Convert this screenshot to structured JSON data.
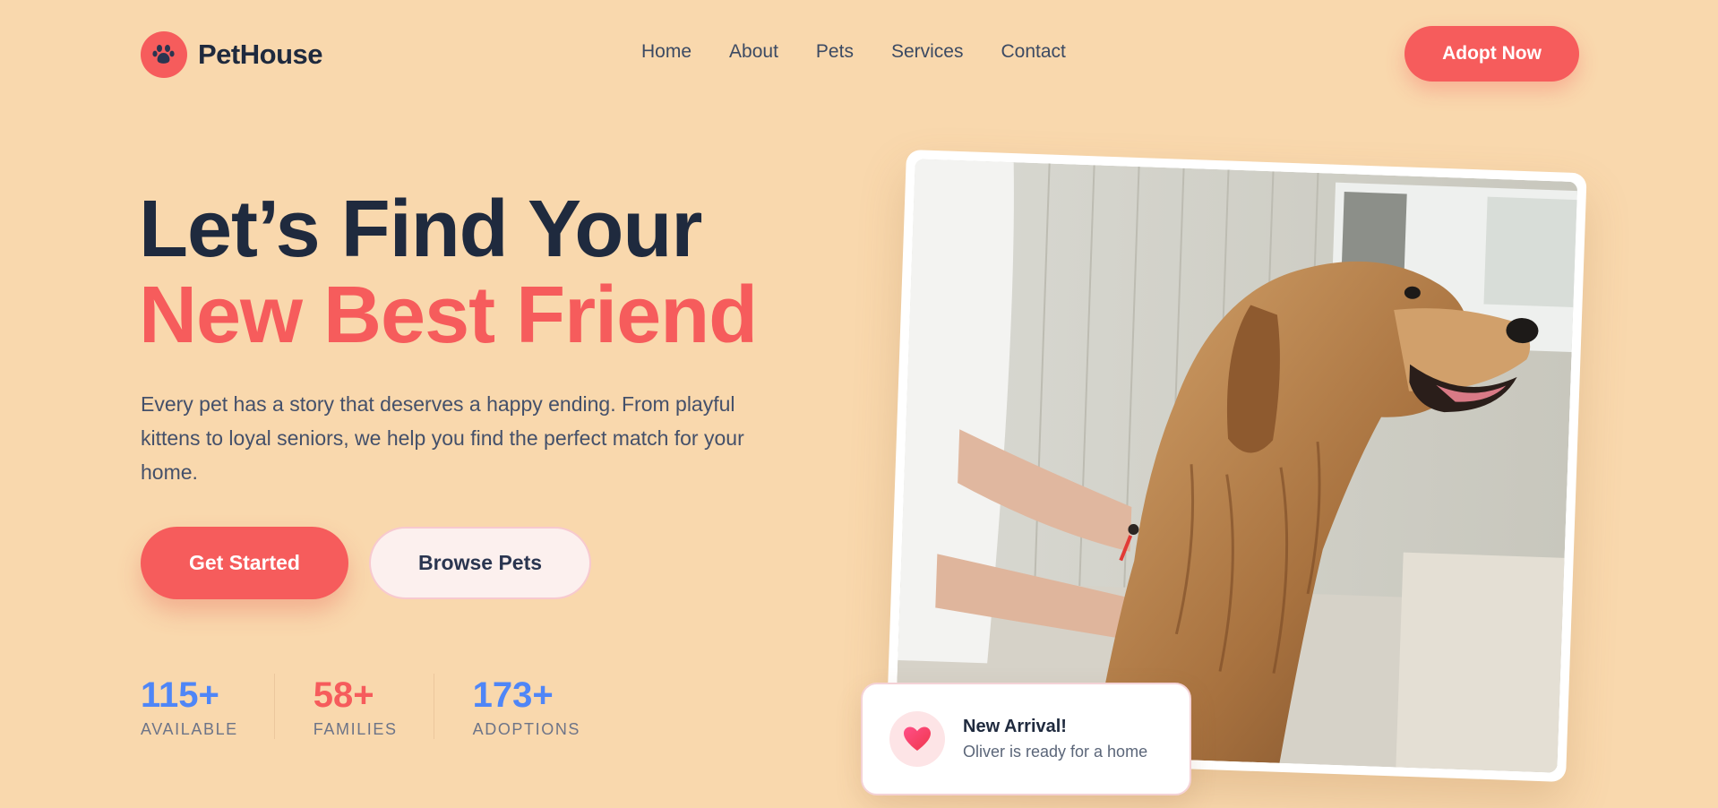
{
  "header": {
    "brand": "PetHouse",
    "brand_icon": "paw-icon",
    "nav": [
      {
        "label": "Home"
      },
      {
        "label": "About"
      },
      {
        "label": "Pets"
      },
      {
        "label": "Services"
      },
      {
        "label": "Contact"
      }
    ],
    "cta_label": "Adopt Now"
  },
  "hero": {
    "headline_line1": "Let’s Find Your",
    "headline_line2": "New Best Friend",
    "description": "Every pet has a story that deserves a happy ending. From playful kittens to loyal seniors, we help you find the perfect match for your home.",
    "primary_button": "Get Started",
    "secondary_button": "Browse Pets",
    "stats": [
      {
        "value": "115+",
        "label": "AVAILABLE",
        "color": "#4f86f7"
      },
      {
        "value": "58+",
        "label": "FAMILIES",
        "color": "#f65c5c"
      },
      {
        "value": "173+",
        "label": "ADOPTIONS",
        "color": "#4f86f7"
      }
    ]
  },
  "notification": {
    "icon": "heart-icon",
    "title": "New Arrival!",
    "subtitle": "Oliver is ready for a home"
  },
  "colors": {
    "background": "#f9d8ad",
    "accent": "#f65c5c",
    "dark_text": "#1f2a3e",
    "stat_blue": "#4f86f7"
  }
}
